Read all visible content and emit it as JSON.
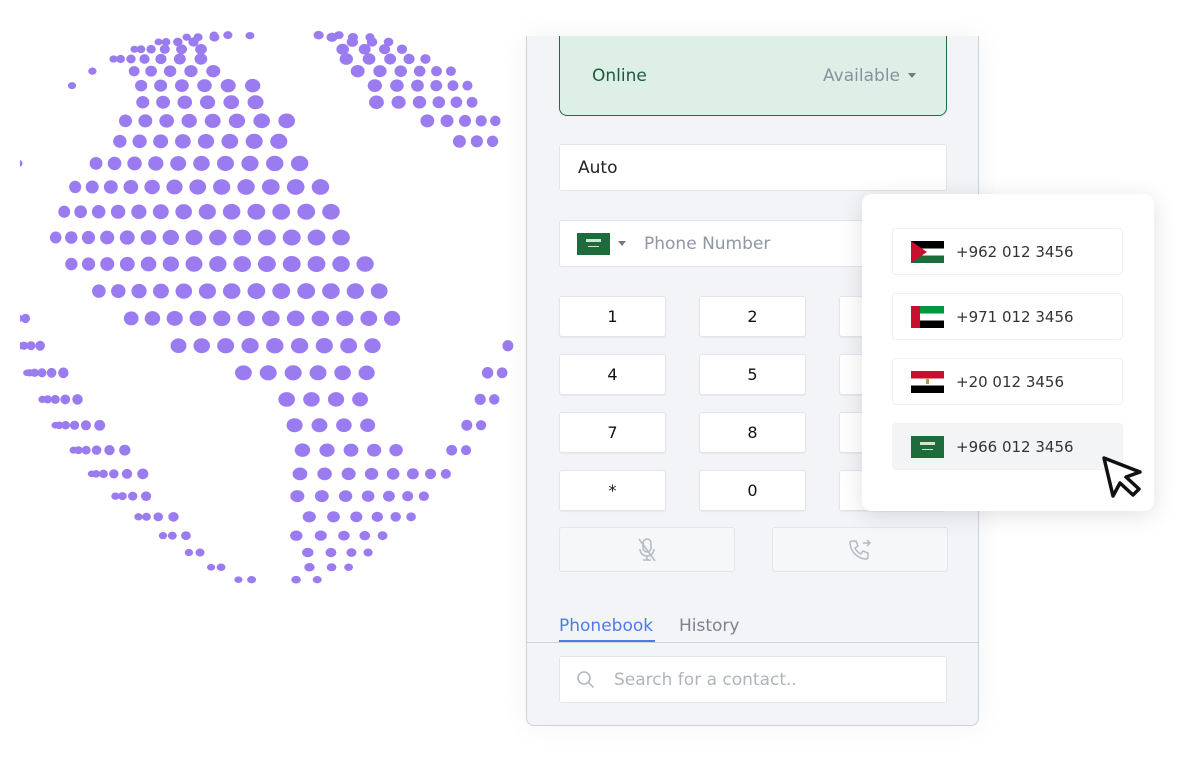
{
  "colors": {
    "globe_dots": "#9b7cf0",
    "status_bg": "#deefe8",
    "status_border": "#1f6b46",
    "tab_active": "#4d7be6",
    "sa_green": "#1e6b3c"
  },
  "status": {
    "label": "Online",
    "availability": "Available"
  },
  "mode_field": {
    "value": "Auto"
  },
  "phone_field": {
    "country_flag": "saudi-arabia",
    "placeholder": "Phone Number"
  },
  "keypad": {
    "keys": [
      "1",
      "2",
      "",
      "4",
      "5",
      "",
      "7",
      "8",
      "",
      "*",
      "0",
      ""
    ]
  },
  "actions": {
    "mute_icon": "mic-off-icon",
    "transfer_icon": "phone-forward-icon"
  },
  "tabs": [
    {
      "label": "Phonebook",
      "active": true
    },
    {
      "label": "History",
      "active": false
    }
  ],
  "search": {
    "placeholder": "Search for a contact.."
  },
  "country_dropdown": {
    "items": [
      {
        "flag": "jordan",
        "number": "+962 012 3456"
      },
      {
        "flag": "uae",
        "number": "+971 012 3456"
      },
      {
        "flag": "egypt",
        "number": "+20 012 3456"
      },
      {
        "flag": "saudi-arabia",
        "number": "+966 012 3456",
        "hovered": true
      }
    ]
  }
}
